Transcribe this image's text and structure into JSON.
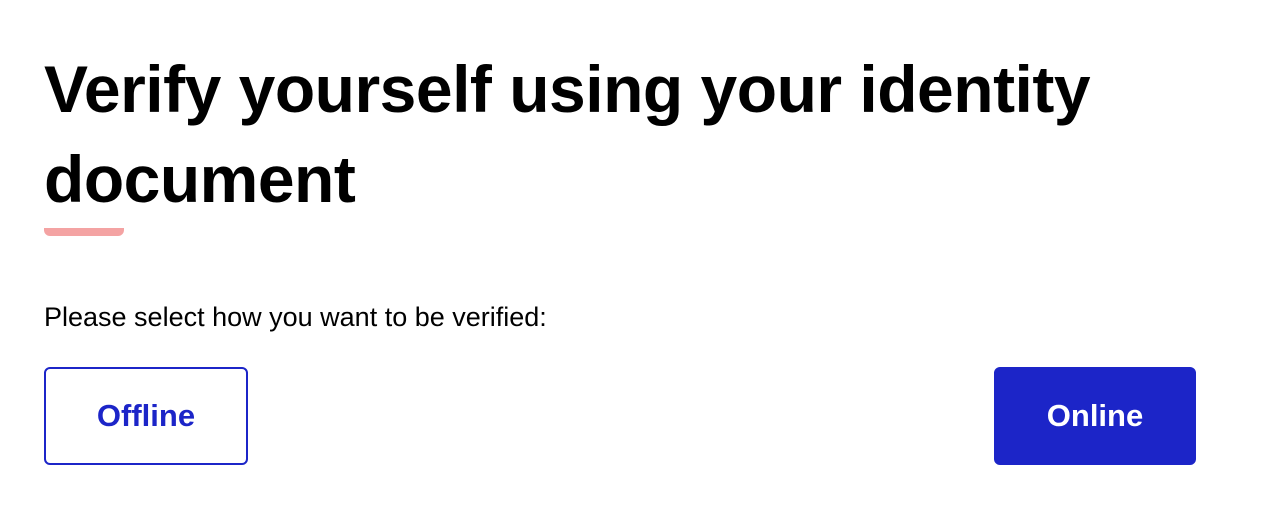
{
  "page": {
    "title": "Verify yourself using your identity document",
    "prompt": "Please select how you want to be verified:"
  },
  "options": {
    "offline_label": "Offline",
    "online_label": "Online"
  },
  "colors": {
    "accent": "#1c25c8",
    "underline": "#f4a3a3",
    "text": "#000000",
    "background": "#ffffff"
  }
}
